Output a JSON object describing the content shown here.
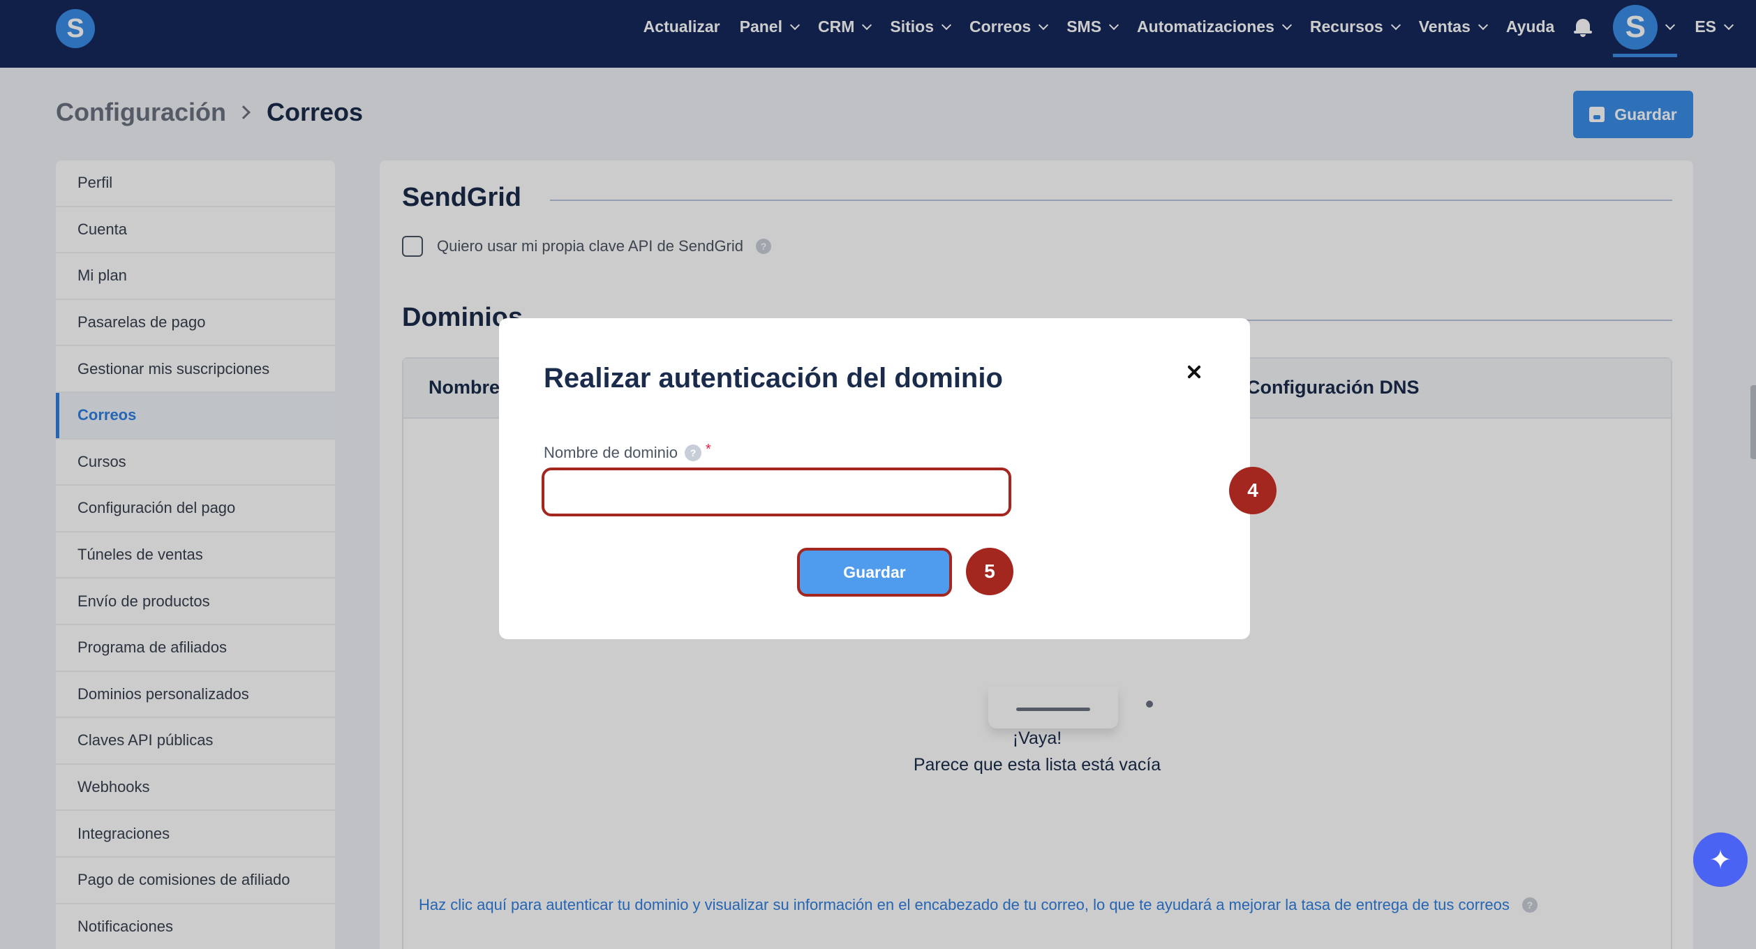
{
  "app": {
    "logo_letter": "S"
  },
  "topnav": {
    "items": [
      {
        "label": "Actualizar",
        "dropdown": false
      },
      {
        "label": "Panel",
        "dropdown": true
      },
      {
        "label": "CRM",
        "dropdown": true
      },
      {
        "label": "Sitios",
        "dropdown": true
      },
      {
        "label": "Correos",
        "dropdown": true
      },
      {
        "label": "SMS",
        "dropdown": true
      },
      {
        "label": "Automatizaciones",
        "dropdown": true
      },
      {
        "label": "Recursos",
        "dropdown": true
      },
      {
        "label": "Ventas",
        "dropdown": true
      },
      {
        "label": "Ayuda",
        "dropdown": false
      }
    ],
    "avatar_letter": "S",
    "language": "ES"
  },
  "breadcrumb": {
    "parent": "Configuración",
    "current": "Correos"
  },
  "header": {
    "save_label": "Guardar"
  },
  "sidebar": {
    "items": [
      {
        "label": "Perfil"
      },
      {
        "label": "Cuenta"
      },
      {
        "label": "Mi plan"
      },
      {
        "label": "Pasarelas de pago"
      },
      {
        "label": "Gestionar mis suscripciones"
      },
      {
        "label": "Correos",
        "active": true
      },
      {
        "label": "Cursos"
      },
      {
        "label": "Configuración del pago"
      },
      {
        "label": "Túneles de ventas"
      },
      {
        "label": "Envío de productos"
      },
      {
        "label": "Programa de afiliados"
      },
      {
        "label": "Dominios personalizados"
      },
      {
        "label": "Claves API públicas"
      },
      {
        "label": "Webhooks"
      },
      {
        "label": "Integraciones"
      },
      {
        "label": "Pago de comisiones de afiliado"
      },
      {
        "label": "Notificaciones"
      }
    ]
  },
  "main": {
    "sendgrid": {
      "title": "SendGrid",
      "checkbox_label": "Quiero usar mi propia clave API de SendGrid",
      "checked": false,
      "help_glyph": "?"
    },
    "domains": {
      "title": "Dominios",
      "columns": [
        "Nombre",
        "Configuración DNS"
      ],
      "empty_title": "¡Vaya!",
      "empty_subtitle": "Parece que esta lista está vacía",
      "footer_link": "Haz clic aquí para autenticar tu dominio y visualizar su información en el encabezado de tu correo, lo que te ayudará a mejorar la tasa de entrega de tus correos",
      "help_glyph": "?"
    }
  },
  "modal": {
    "title": "Realizar autenticación del dominio",
    "close_glyph": "×",
    "field_label": "Nombre de dominio",
    "field_help_glyph": "?",
    "required_mark": "*",
    "field_value": "",
    "save_label": "Guardar",
    "step_badges": [
      "4",
      "5"
    ]
  },
  "fab": {
    "icon": "sparkles-icon",
    "glyph": "✦"
  },
  "colors": {
    "nav_bg": "#15285a",
    "accent": "#3b8ee8",
    "highlight": "#a3261f",
    "fab": "#4b63f2"
  }
}
